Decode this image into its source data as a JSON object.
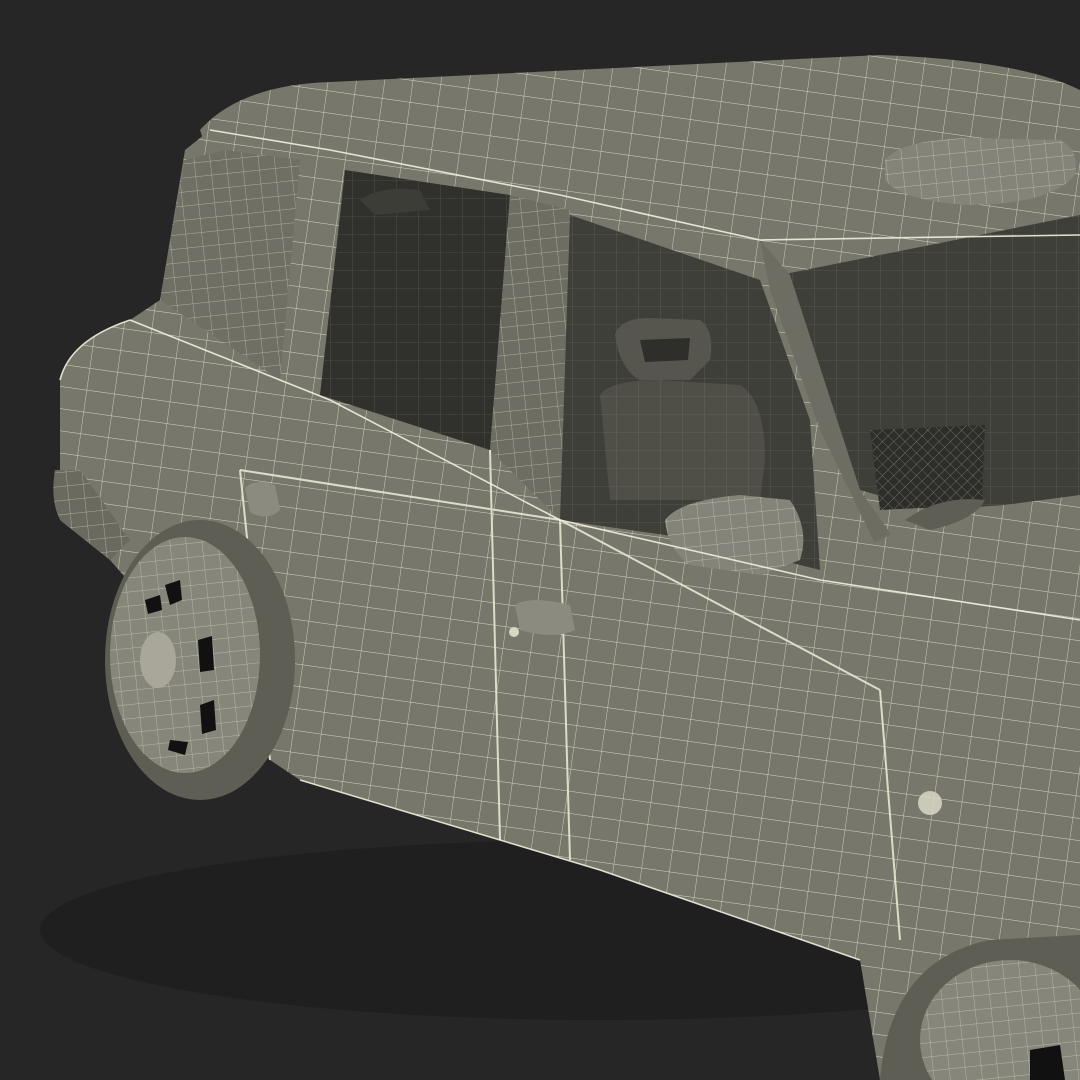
{
  "scene": {
    "subject": "3d-car-wireframe-render",
    "colors": {
      "background": "#262626",
      "body": "#77776c",
      "body_shadow": "#5e5e55",
      "window": "#3f3f3a",
      "window_dark": "#30302c",
      "interior": "#4f4f48",
      "wire": "#e9e7d2",
      "wheel": "#86867b",
      "hole": "#111111"
    }
  }
}
